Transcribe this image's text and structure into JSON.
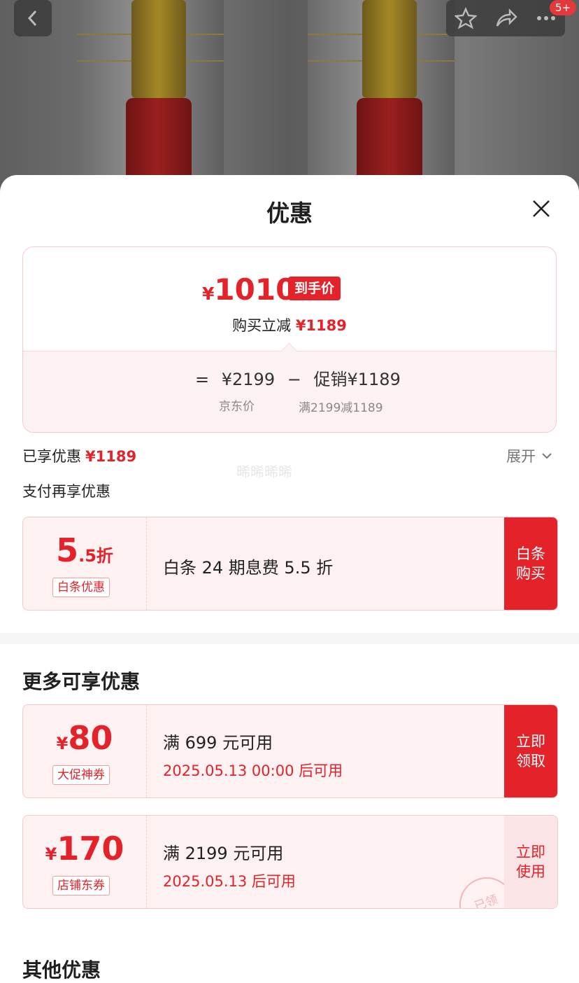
{
  "header": {
    "badge_count": "5+"
  },
  "sheet": {
    "title": "优惠"
  },
  "price_card": {
    "currency": "¥",
    "final_price": "1010",
    "final_tag": "到手价",
    "reduce_label": "购买立减",
    "reduce_value": "¥1189",
    "equals": "=",
    "jd_price": "¥2199",
    "minus": "−",
    "promo_label": "促销",
    "promo_value": "¥1189",
    "jd_price_label": "京东价",
    "promo_rule": "满2199减1189"
  },
  "enjoyed": {
    "label": "已享优惠",
    "value": "¥1189",
    "expand_label": "展开"
  },
  "watermark": "晞晞晞晞",
  "payment": {
    "title": "支付再享优惠",
    "coupon": {
      "amount_big": "5",
      "amount_small": ".5折",
      "tag": "白条优惠",
      "desc": "白条 24 期息费 5.5 折",
      "cta": "白条\n购买"
    }
  },
  "more": {
    "title": "更多可享优惠",
    "coupons": [
      {
        "currency": "¥",
        "amount": "80",
        "tag": "大促神券",
        "desc": "满 699 元可用",
        "date": "2025.05.13 00:00 后可用",
        "cta": "立即\n领取"
      },
      {
        "currency": "¥",
        "amount": "170",
        "tag": "店铺东券",
        "desc": "满 2199 元可用",
        "date": "2025.05.13 后可用",
        "cta": "立即\n使用",
        "stamp": "已领"
      }
    ]
  },
  "other": {
    "title": "其他优惠"
  },
  "colors": {
    "accent": "#e4222a",
    "coupon_bg": "#fdf1f2",
    "muted": "#888888"
  }
}
